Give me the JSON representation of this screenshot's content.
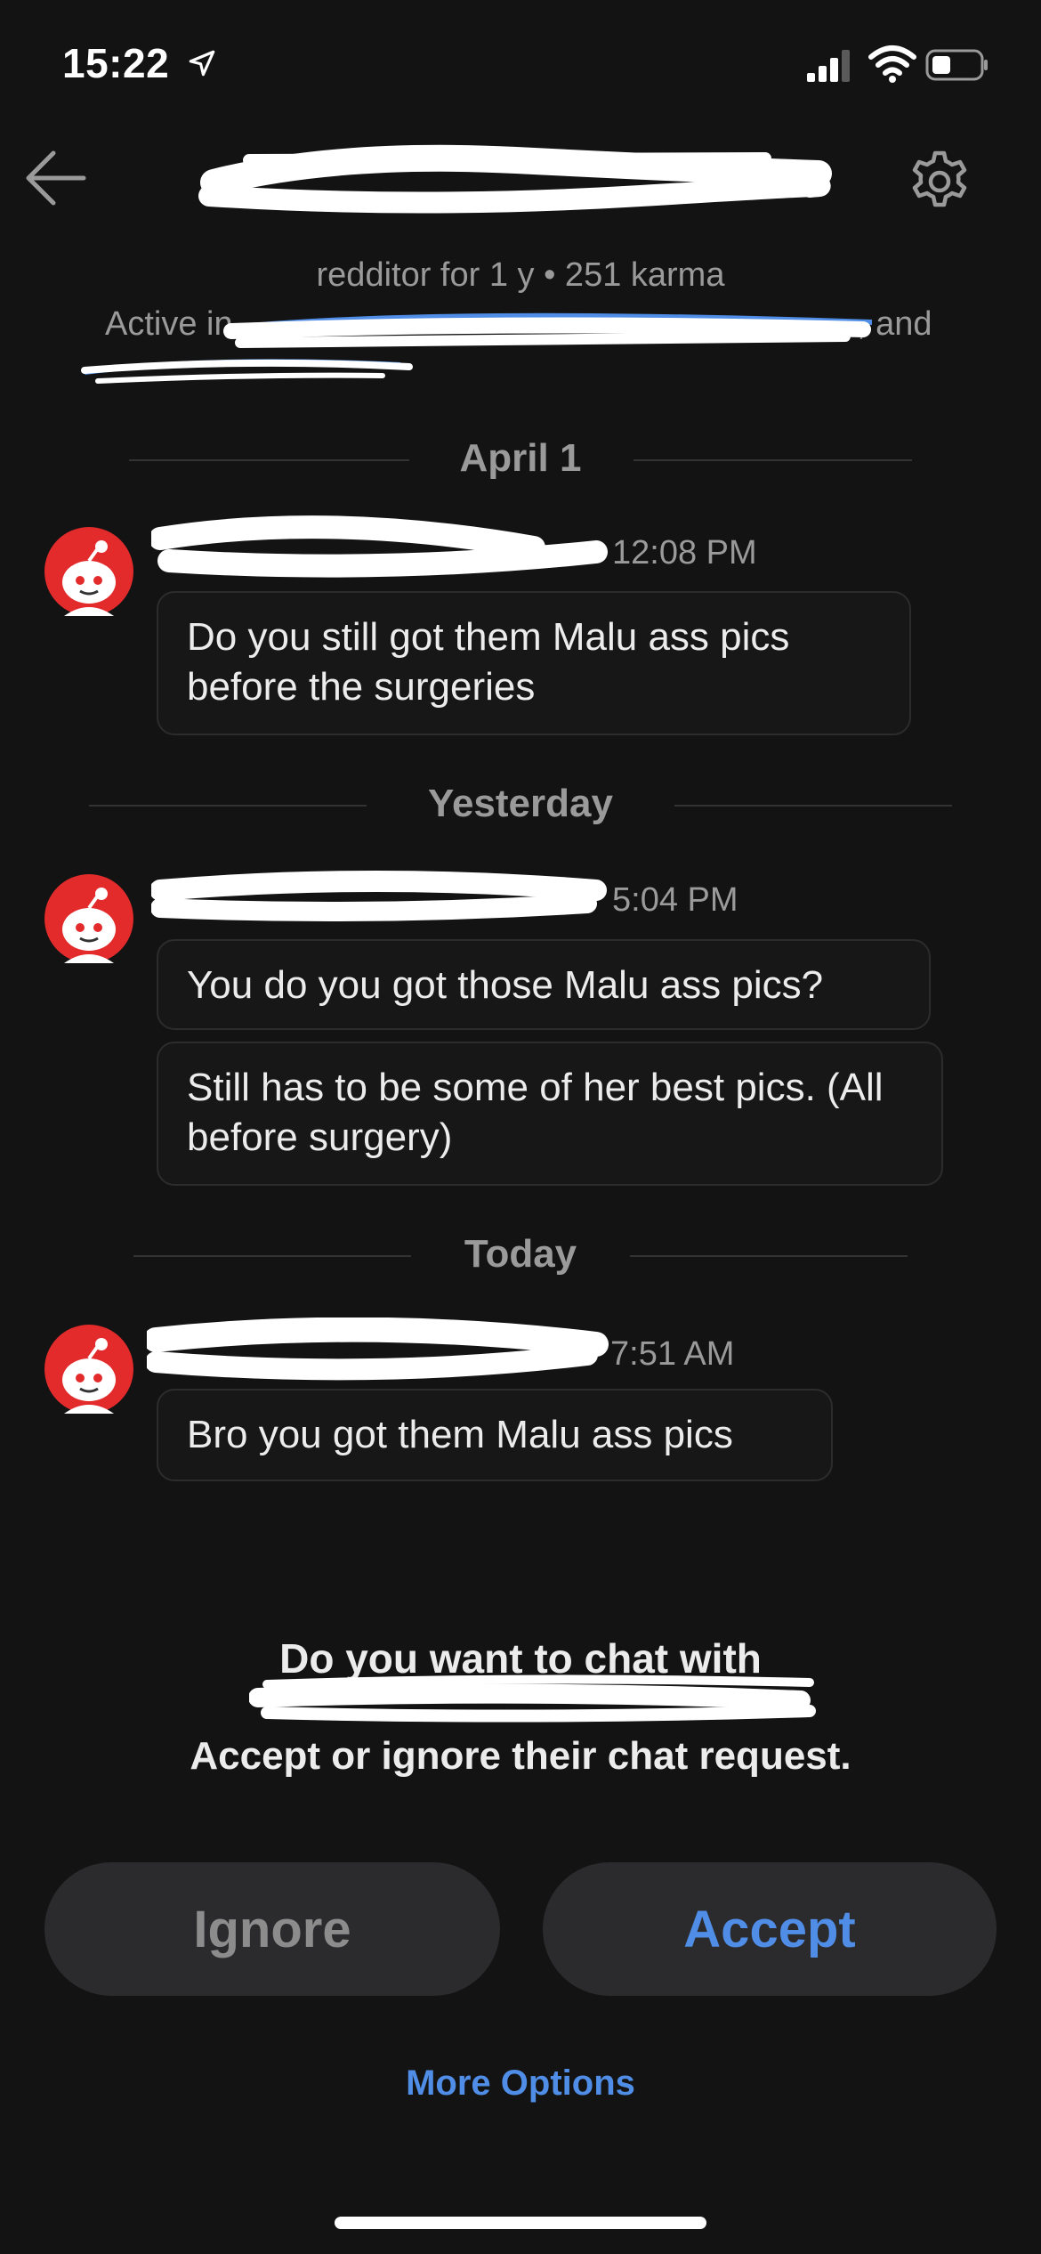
{
  "status_bar": {
    "time": "15:22",
    "icons": [
      "location-arrow-icon",
      "signal-icon",
      "wifi-icon",
      "battery-icon"
    ]
  },
  "header": {
    "back_icon": "back-arrow-icon",
    "settings_icon": "gear-icon"
  },
  "profile": {
    "info": "redditor for 1 y • 251 karma",
    "active_prefix": "Active in",
    "active_suffix": ", and",
    "redaction_note": ""
  },
  "conversation": {
    "groups": [
      {
        "date": "April 1",
        "time": "12:08 PM",
        "messages": [
          "Do you still got them Malu ass pics before the surgeries"
        ]
      },
      {
        "date": "Yesterday",
        "time": "5:04 PM",
        "messages": [
          "You do you got those Malu ass pics?",
          "Still has to be some of her best pics. (All before surgery)"
        ]
      },
      {
        "date": "Today",
        "time": "7:51 AM",
        "messages": [
          "Bro you got them Malu ass pics"
        ]
      }
    ]
  },
  "request": {
    "question": "Do you want to chat with",
    "instruction": "Accept or ignore their chat request."
  },
  "actions": {
    "ignore_label": "Ignore",
    "accept_label": "Accept",
    "more_options_label": "More Options"
  },
  "colors": {
    "background": "#131313",
    "accent": "#4f8de6",
    "avatar_red": "#e32b2b"
  }
}
